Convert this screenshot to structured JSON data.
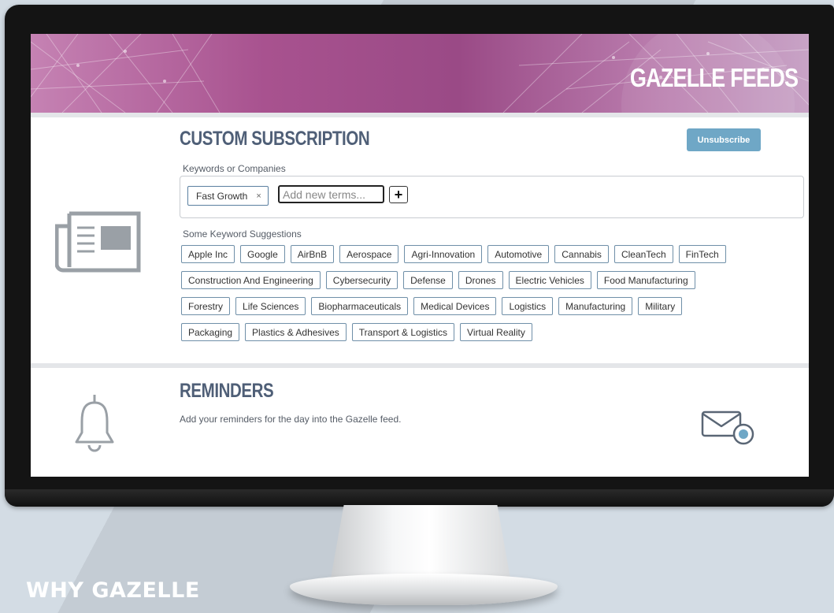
{
  "banner": {
    "title": "GAZELLE FEEDS"
  },
  "subscription": {
    "title": "CUSTOM SUBSCRIPTION",
    "unsubscribe_label": "Unsubscribe",
    "keywords_label": "Keywords or Companies",
    "current_term": "Fast Growth",
    "remove_symbol": "×",
    "input_placeholder": "Add new terms...",
    "add_symbol": "+",
    "suggestions_label": "Some Keyword Suggestions",
    "suggestion_rows": [
      [
        "Apple Inc",
        "Google",
        "AirBnB",
        "Aerospace",
        "Agri-Innovation",
        "Automotive",
        "Cannabis",
        "CleanTech",
        "FinTech"
      ],
      [
        "Construction And Engineering",
        "Cybersecurity",
        "Defense",
        "Drones",
        "Electric Vehicles",
        "Food Manufacturing"
      ],
      [
        "Forestry",
        "Life Sciences",
        "Biopharmaceuticals",
        "Medical Devices",
        "Logistics",
        "Manufacturing",
        "Military"
      ],
      [
        "Packaging",
        "Plastics & Adhesives",
        "Transport & Logistics",
        "Virtual Reality"
      ]
    ]
  },
  "reminders": {
    "title": "REMINDERS",
    "description": "Add your reminders for the day into the Gazelle feed."
  },
  "footer": {
    "why_gazelle": "WHY GAZELLE"
  },
  "colors": {
    "banner_accent": "#9a4a86",
    "title_color": "#4f5f77",
    "button_blue": "#6fa7c6",
    "chip_border": "#6f8fa8",
    "icon_gray": "#9aa0a6"
  },
  "icons": {
    "subscription": "newspaper-icon",
    "reminders": "bell-icon",
    "reminder_action": "mail-settings-icon"
  }
}
